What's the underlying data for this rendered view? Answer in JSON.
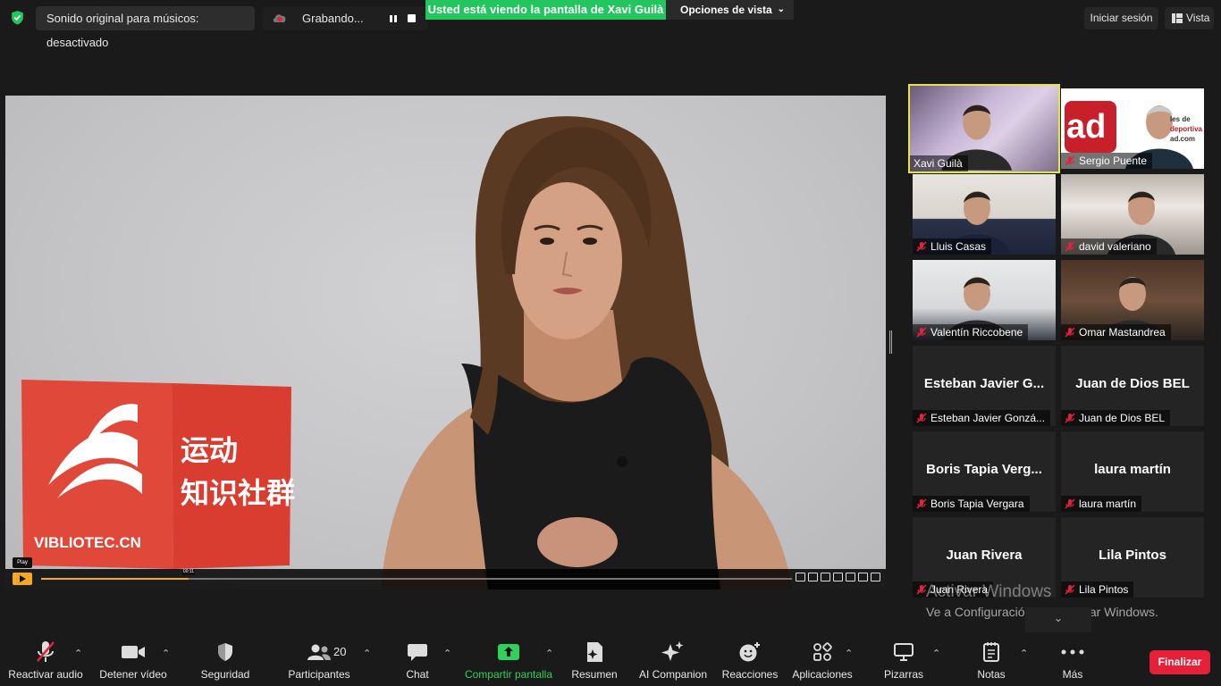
{
  "top": {
    "original_sound": "Sonido original para músicos: desactivado",
    "recording": "Grabando...",
    "viewing_banner": "Usted está viendo la pantalla de Xavi Guilà",
    "view_options": "Opciones de vista",
    "sign_in": "Iniciar sesión",
    "view": "Vista"
  },
  "shared_screen": {
    "box_brand": "VIBLIOTEC.CN",
    "box_line1": "运动",
    "box_line2": "知识社群",
    "player_tooltip": "Play",
    "player_time": "00:11",
    "progress": 0.196
  },
  "participants": [
    {
      "name": "Xavi Guilà",
      "tag": "Xavi Guilà",
      "muted": false,
      "video": true,
      "active": true
    },
    {
      "name": "Sergio Puente",
      "tag": "Sergio Puente",
      "muted": true,
      "video": true,
      "active": false,
      "overlay_text": "ad",
      "overlay_lines": [
        "les de",
        "deportiva",
        "ad.com"
      ]
    },
    {
      "name": "Lluis Casas",
      "tag": "Lluis Casas",
      "muted": true,
      "video": true
    },
    {
      "name": "david valeriano",
      "tag": "david valeriano",
      "muted": true,
      "video": true
    },
    {
      "name": "Valentín Riccobene",
      "tag": "Valentín Riccobene",
      "muted": true,
      "video": true
    },
    {
      "name": "Omar Mastandrea",
      "tag": "Omar Mastandrea",
      "muted": true,
      "video": true
    },
    {
      "name": "Esteban Javier G...",
      "tag": "Esteban Javier Gonzá...",
      "muted": true,
      "video": false
    },
    {
      "name": "Juan de Dios BEL",
      "tag": "Juan de Dios BEL",
      "muted": true,
      "video": false
    },
    {
      "name": "Boris Tapia Verg...",
      "tag": "Boris Tapia Vergara",
      "muted": true,
      "video": false
    },
    {
      "name": "laura martín",
      "tag": "laura martín",
      "muted": true,
      "video": false
    },
    {
      "name": "Juan Rivera",
      "tag": "Juan Rivera",
      "muted": true,
      "video": false
    },
    {
      "name": "Lila Pintos",
      "tag": "Lila Pintos",
      "muted": true,
      "video": false
    }
  ],
  "watermark": {
    "line1": "Activar Windows",
    "line2": "Ve a Configuración para activar Windows."
  },
  "toolbar": {
    "unmute": "Reactivar audio",
    "stop_video": "Detener vídeo",
    "security": "Seguridad",
    "participants": "Participantes",
    "participants_count": "20",
    "chat": "Chat",
    "share": "Compartir pantalla",
    "summary": "Resumen",
    "ai": "AI Companion",
    "reactions": "Reacciones",
    "apps": "Aplicaciones",
    "whiteboards": "Pizarras",
    "notes": "Notas",
    "more": "Más",
    "end": "Finalizar"
  },
  "colors": {
    "accent_green": "#22c55e",
    "active_speaker": "#e6e34a",
    "end_red": "#e5213a",
    "mute_red": "#e5213a"
  }
}
